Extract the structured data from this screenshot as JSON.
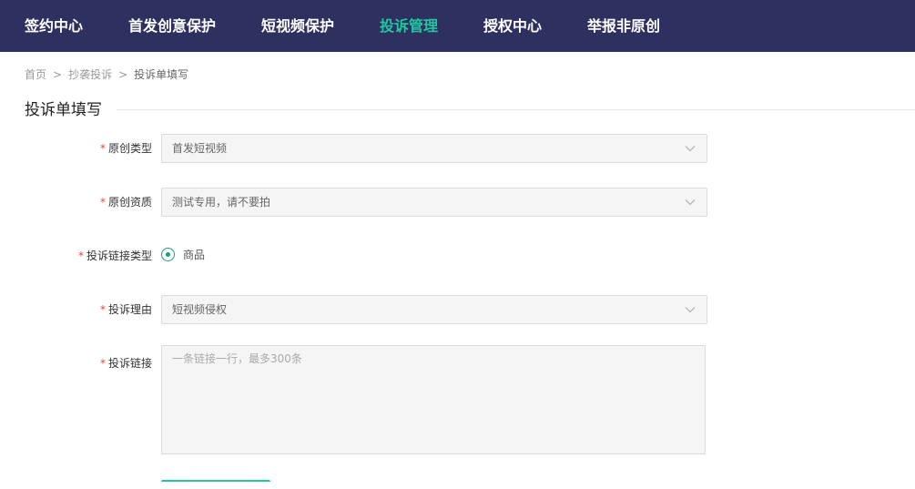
{
  "nav": {
    "items": [
      {
        "label": "签约中心",
        "active": false
      },
      {
        "label": "首发创意保护",
        "active": false
      },
      {
        "label": "短视频保护",
        "active": false
      },
      {
        "label": "投诉管理",
        "active": true
      },
      {
        "label": "授权中心",
        "active": false
      },
      {
        "label": "举报非原创",
        "active": false
      }
    ],
    "active_color": "#1fc8a0",
    "background_color": "#2e3160"
  },
  "breadcrumb": {
    "items": [
      "首页",
      "抄袭投诉",
      "投诉单填写"
    ],
    "separator": ">"
  },
  "section": {
    "title": "投诉单填写"
  },
  "form": {
    "required_mark": "*",
    "original_type": {
      "label": "原创类型",
      "value": "首发短视频",
      "icon": "chevron-down-icon"
    },
    "original_qualification": {
      "label": "原创资质",
      "value": "测试专用，请不要拍",
      "icon": "chevron-down-icon"
    },
    "link_type": {
      "label": "投诉链接类型",
      "options": [
        {
          "label": "商品",
          "selected": true
        }
      ]
    },
    "reason": {
      "label": "投诉理由",
      "value": "短视频侵权",
      "icon": "chevron-down-icon"
    },
    "links": {
      "label": "投诉链接",
      "value": "",
      "placeholder": "一条链接一行，最多300条"
    }
  }
}
